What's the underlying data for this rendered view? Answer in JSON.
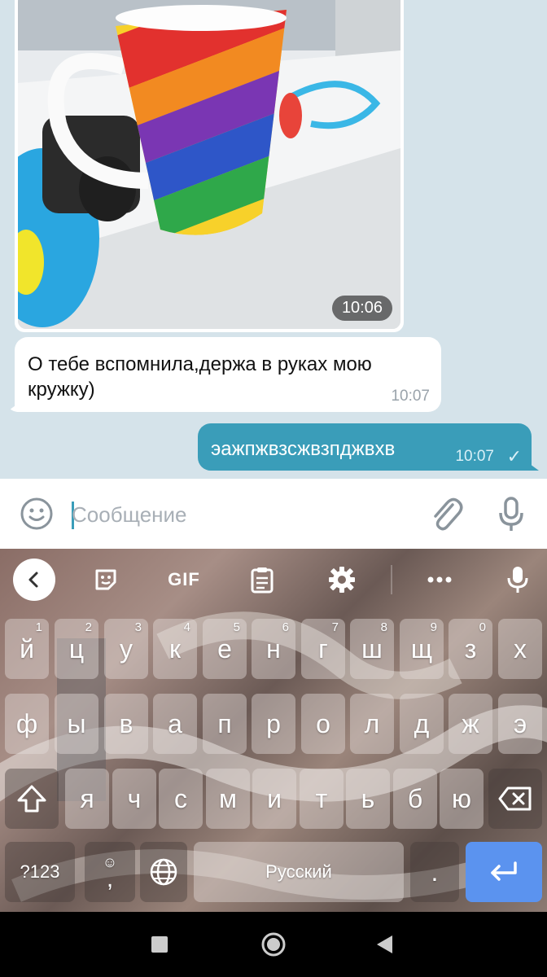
{
  "chat": {
    "photo_time": "10:06",
    "incoming_message": {
      "text": "О тебе вспомнила,держа в руках мою кружку)",
      "time": "10:07"
    },
    "outgoing_message": {
      "text": "эажпжвзсжвзпджвхв",
      "time": "10:07",
      "status": "sent"
    }
  },
  "input_bar": {
    "placeholder": "Сообщение",
    "icons": [
      "smile-icon",
      "paperclip-icon",
      "microphone-icon"
    ]
  },
  "keyboard": {
    "toolbar": {
      "back_icon": "chevron-left-icon",
      "items": [
        "sticker-icon",
        "GIF",
        "clipboard-icon",
        "gear-icon",
        "more-icon",
        "microphone-icon"
      ],
      "gif_label": "GIF"
    },
    "row1": [
      {
        "label": "й",
        "hint": "1"
      },
      {
        "label": "ц",
        "hint": "2"
      },
      {
        "label": "у",
        "hint": "3"
      },
      {
        "label": "к",
        "hint": "4"
      },
      {
        "label": "е",
        "hint": "5"
      },
      {
        "label": "н",
        "hint": "6"
      },
      {
        "label": "г",
        "hint": "7"
      },
      {
        "label": "ш",
        "hint": "8"
      },
      {
        "label": "щ",
        "hint": "9"
      },
      {
        "label": "з",
        "hint": "0"
      },
      {
        "label": "х",
        "hint": ""
      }
    ],
    "row2": [
      "ф",
      "ы",
      "в",
      "а",
      "п",
      "р",
      "о",
      "л",
      "д",
      "ж",
      "э"
    ],
    "row3": [
      "я",
      "ч",
      "с",
      "м",
      "и",
      "т",
      "ь",
      "б",
      "ю"
    ],
    "row4": {
      "symbols_label": "?123",
      "comma_label": ",",
      "space_label": "Русский",
      "period_label": "."
    }
  },
  "colors": {
    "accent": "#3a9db9",
    "chat_background": "#d5e3ea",
    "enter_key": "#5b93ef"
  }
}
